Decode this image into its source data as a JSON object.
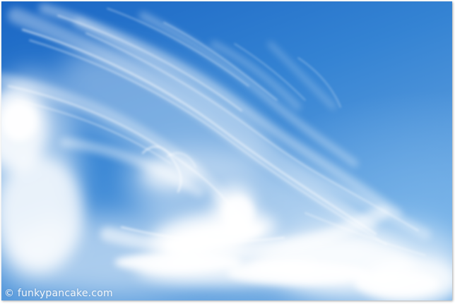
{
  "photo": {
    "subject": "",
    "sky_top_color": "#1f6fc9",
    "sky_mid_color": "#3c8ad6",
    "sky_light_color": "#7fb4e6",
    "cloud_color": "#ffffff"
  },
  "watermark": {
    "text": "© funkypancake.com"
  }
}
